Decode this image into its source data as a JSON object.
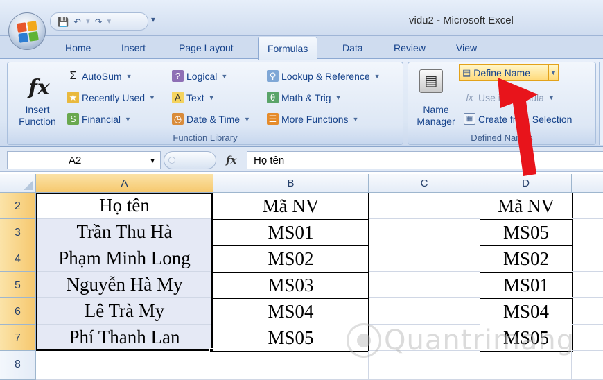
{
  "app": {
    "window_title": "vidu2 - Microsoft Excel"
  },
  "tabs": [
    "Home",
    "Insert",
    "Page Layout",
    "Formulas",
    "Data",
    "Review",
    "View"
  ],
  "active_tab": "Formulas",
  "ribbon": {
    "function_library": {
      "label": "Function Library",
      "insert_function": {
        "line1": "Insert",
        "line2": "Function",
        "icon": "fx"
      },
      "autosum": "AutoSum",
      "autosum_icon": "Σ",
      "recently_used": "Recently Used",
      "financial": "Financial",
      "logical": "Logical",
      "text": "Text",
      "date_time": "Date & Time",
      "lookup_reference": "Lookup & Reference",
      "math_trig": "Math & Trig",
      "more_functions": "More Functions"
    },
    "defined_names": {
      "label": "Defined Names",
      "name_manager": {
        "line1": "Name",
        "line2": "Manager"
      },
      "define_name": "Define Name",
      "use_in_formula": "Use in Formula",
      "create_from_selection": "Create from Selection"
    }
  },
  "formula_bar": {
    "name_box": "A2",
    "fx": "fx",
    "content": "Họ tên"
  },
  "grid": {
    "columns": [
      "A",
      "B",
      "C",
      "D"
    ],
    "rows": [
      "2",
      "3",
      "4",
      "5",
      "6",
      "7",
      "8"
    ],
    "col_a": [
      "Họ tên",
      "Trần Thu Hà",
      "Phạm Minh Long",
      "Nguyễn Hà My",
      "Lê Trà My",
      "Phí Thanh Lan"
    ],
    "col_b": [
      "Mã NV",
      "MS01",
      "MS02",
      "MS03",
      "MS04",
      "MS05"
    ],
    "col_d": [
      "Mã NV",
      "MS05",
      "MS02",
      "MS01",
      "MS04",
      "MS05"
    ]
  },
  "watermark": "Quantrimang",
  "colors": {
    "selected_header": "#f6c86e",
    "highlight_button": "#ffd978",
    "arrow": "#e8141b"
  }
}
